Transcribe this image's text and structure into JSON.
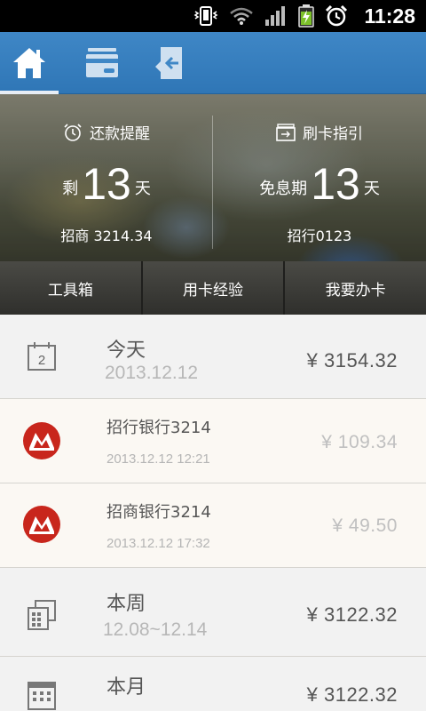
{
  "status_bar": {
    "time": "11:28",
    "icons": [
      "vibrate-icon",
      "wifi-icon",
      "signal-icon",
      "battery-charging-icon",
      "alarm-icon"
    ]
  },
  "nav": {
    "tabs": [
      {
        "icon": "home-icon",
        "active": true
      },
      {
        "icon": "card-icon",
        "active": false
      },
      {
        "icon": "card-return-icon",
        "active": false
      }
    ]
  },
  "hero": {
    "repayment": {
      "title": "还款提醒",
      "prefix": "剩",
      "number": "13",
      "unit": "天",
      "sub": "招商 3214.34"
    },
    "card_guide": {
      "title": "刷卡指引",
      "prefix": "免息期",
      "number": "13",
      "unit": "天",
      "sub": "招行0123"
    }
  },
  "toolbar": {
    "items": [
      "工具箱",
      "用卡经验",
      "我要办卡"
    ]
  },
  "list": {
    "today": {
      "title": "今天",
      "date": "2013.12.12",
      "amount": "¥ 3154.32",
      "icon_text": "2"
    },
    "transactions": [
      {
        "title": "招行银行3214",
        "datetime": "2013.12.12    12:21",
        "amount": "¥ 109.34"
      },
      {
        "title": "招商银行3214",
        "datetime": "2013.12.12    17:32",
        "amount": "¥ 49.50"
      }
    ],
    "week": {
      "title": "本周",
      "range": "12.08~12.14",
      "amount": "¥ 3122.32"
    },
    "month": {
      "title": "本月",
      "amount": "¥ 3122.32"
    }
  },
  "colors": {
    "nav_blue": "#3f87c6",
    "bank_red": "#c8261c",
    "toolbar_dark": "#3a3a36"
  }
}
